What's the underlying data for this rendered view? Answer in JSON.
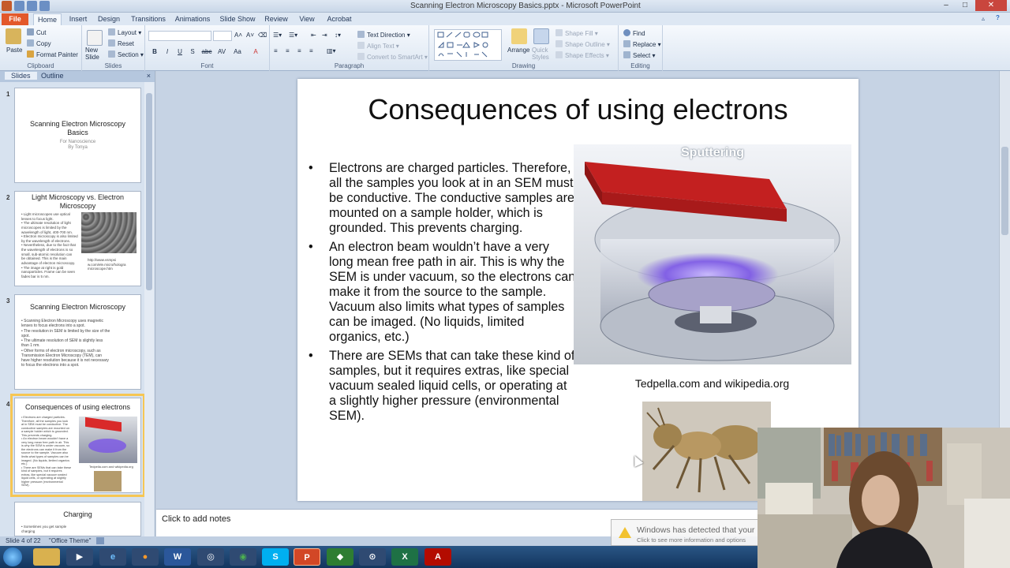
{
  "window": {
    "title": "Scanning Electron Microscopy Basics.pptx - Microsoft PowerPoint",
    "controls": [
      "–",
      "□",
      "✕"
    ]
  },
  "tabs": [
    "File",
    "Home",
    "Insert",
    "Design",
    "Transitions",
    "Animations",
    "Slide Show",
    "Review",
    "View",
    "Acrobat"
  ],
  "ribbon": {
    "clipboard": {
      "paste": "Paste",
      "cut": "Cut",
      "copy": "Copy",
      "format_painter": "Format Painter",
      "label": "Clipboard"
    },
    "slides": {
      "new_slide": "New Slide",
      "layout": "Layout",
      "reset": "Reset",
      "section": "Section",
      "label": "Slides"
    },
    "font": {
      "label": "Font",
      "buttons": [
        "B",
        "I",
        "U",
        "S",
        "abc",
        "AV",
        "Aa",
        "A"
      ]
    },
    "paragraph": {
      "label": "Paragraph",
      "text_direction": "Text Direction",
      "align_text": "Align Text",
      "smartart": "Convert to SmartArt"
    },
    "drawing": {
      "label": "Drawing",
      "arrange": "Arrange",
      "quick_styles": "Quick Styles",
      "shape_fill": "Shape Fill",
      "shape_outline": "Shape Outline",
      "shape_effects": "Shape Effects"
    },
    "editing": {
      "label": "Editing",
      "find": "Find",
      "replace": "Replace",
      "select": "Select"
    }
  },
  "left_pane": {
    "tabs": [
      "Slides",
      "Outline"
    ],
    "close": "×",
    "thumbnails": [
      {
        "num": "1",
        "title": "Scanning Electron Microscopy Basics",
        "sub": "For Nanoscience\nBy Tonya"
      },
      {
        "num": "2",
        "title": "Light Microscopy vs. Electron Microscopy",
        "text": "• Light microscopes use optical\n lenses to focus light.\n• The ultimate resolution of light\n microscopes is limited by the\n wavelength of light, 400-700 nm.\n• Electron microscopy is also limited\n by the wavelength of electrons.\n• Nevertheless, due to the fact that\n the wavelength of electrons is so\n small, sub-atomic resolution can\n be obtained.  This is the main\n advantage of electron microscopy.\n• The image at right is gold\n nanoparticles.  Frame can be seen\n fades bar is 5 nm.",
        "link": "http://www.vsmpsi\nw.com/ele.micro/hologra\nmicroscope.htm"
      },
      {
        "num": "3",
        "title": "Scanning Electron Microscopy",
        "text": "• Scanning Electron Microscopy uses magnetic\n lenses to focus electrons into a spot.\n• The resolution in SEM is limited by the size of the\n spot.\n• The ultimate resolution of SEM is slightly less\n than 1 nm.\n• Other forms of electron microscopy, such as\n Transmission Electron Microscopy (TEM), can\n have higher resolution because it is not necessary\n to focus the electrons into a spot."
      },
      {
        "num": "4",
        "title": "Consequences of using electrons",
        "text": "• Electrons are charged particles.\n Therefore, all the samples you look\n at in SEM must be conductive. The\n conductive samples are mounted on\n a sample holder which is grounded.\n This prevents charging.\n• An electron beam wouldn't have a\n very long mean free path in air. This\n is why the SEM is under vacuum, so\n the electrons can make it from the\n source to the sample. Vacuum also\n limits what types of samples can be\n imaged. (No liquids, limited organics\n etc.)\n• There are SEMs that can take these\n kind of samples, but it requires\n extras, like special vacuum sealed\n liquid cells, or operating at slightly\n higher pressure (environmental\n SEM).",
        "caption": "Tedpella.com and wikipedia.org"
      },
      {
        "num": "",
        "title": "Charging",
        "text": "• Sometimes you get sample\n charging"
      }
    ]
  },
  "slide": {
    "title": "Consequences of using electrons",
    "bullets": [
      "Electrons are charged particles. Therefore, all the samples you look at in an SEM must be conductive.  The conductive samples are mounted on a sample holder, which is grounded.  This prevents charging.",
      "An electron beam wouldn’t have a very long mean free path in air.  This is why the SEM is under vacuum, so the electrons can make it from the source to the sample.  Vacuum also limits what types of samples can be imaged. (No liquids, limited organics, etc.)",
      "There are SEMs that can take these kind of samples, but it requires extras, like special vacuum sealed liquid cells, or operating at a slightly higher pressure (environmental SEM)."
    ],
    "image_label": "Sputtering",
    "caption": "Tedpella.com and wikipedia.org"
  },
  "notes": {
    "placeholder": "Click to add notes"
  },
  "statusbar": {
    "slide": "Slide 4 of 22",
    "theme": "\"Office Theme\""
  },
  "notification": {
    "line1": "Windows has detected that your",
    "line2": "Click to see more information and options"
  },
  "taskbar": {
    "apps": [
      "explorer",
      "media-player",
      "ie",
      "firefox",
      "word",
      "app",
      "chrome",
      "skype",
      "powerpoint",
      "green-app",
      "app2",
      "excel",
      "acrobat"
    ]
  },
  "colors": {
    "accent": "#f6c653",
    "file_tab": "#e3582a",
    "ribbon": "#dce6f2",
    "red_lid": "#d92a2a",
    "plasma": "#7a55e6"
  }
}
